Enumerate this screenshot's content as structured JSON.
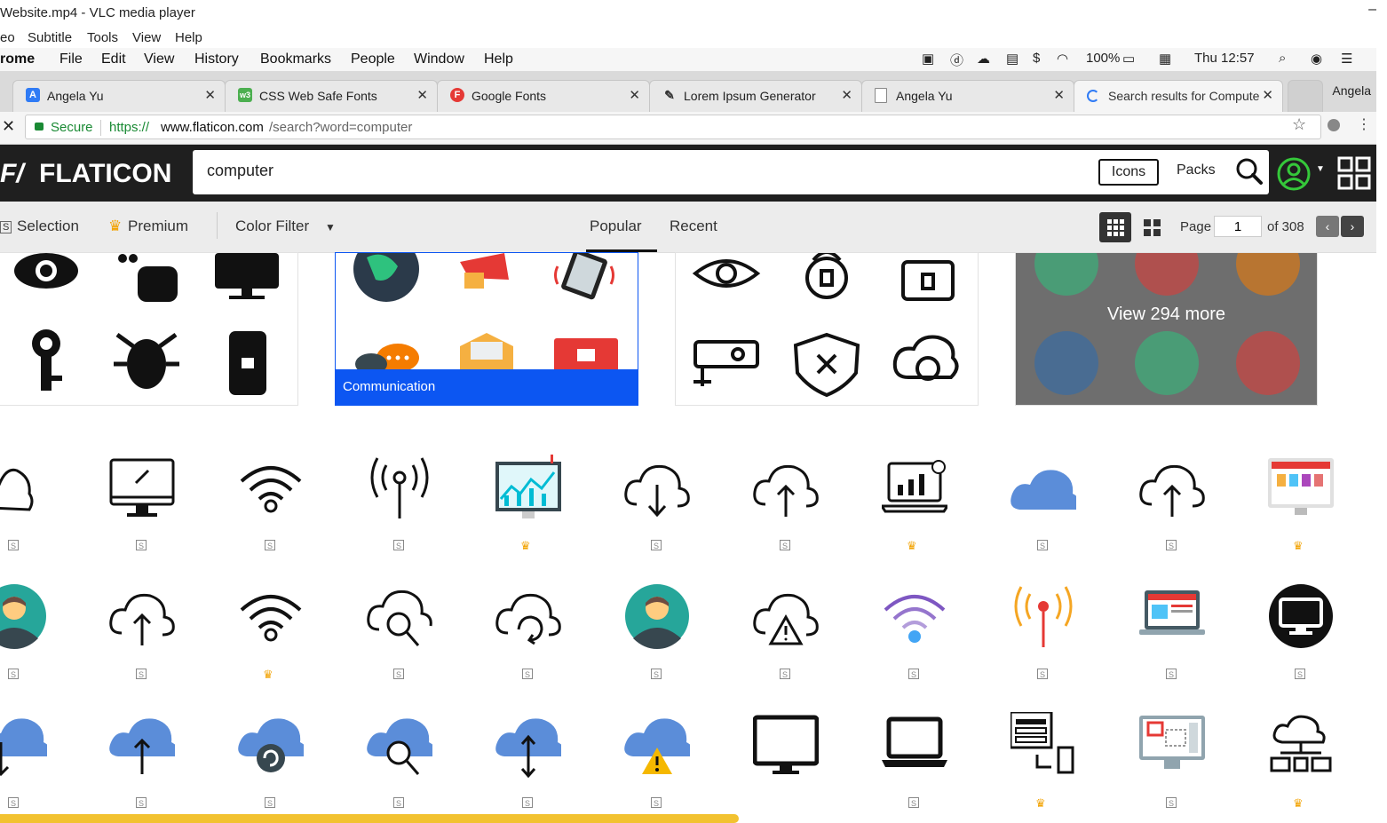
{
  "vlc": {
    "title": "Website.mp4 - VLC media player",
    "minimize": "–",
    "menu": [
      "eo",
      "Subtitle",
      "Tools",
      "View",
      "Help"
    ]
  },
  "mac": {
    "app": "rome",
    "menu": [
      "File",
      "Edit",
      "View",
      "History",
      "Bookmarks",
      "People",
      "Window",
      "Help"
    ],
    "battery": "100%",
    "clock": "Thu 12:57"
  },
  "tabs": [
    {
      "label": "Angela Yu",
      "favicon": "A",
      "color": "#2f7bf5"
    },
    {
      "label": "CSS Web Safe Fonts",
      "favicon": "w3",
      "color": "#4caf50"
    },
    {
      "label": "Google Fonts",
      "favicon": "F",
      "color": "#e53935"
    },
    {
      "label": "Lorem Ipsum Generator",
      "favicon": "✎",
      "color": "#333333"
    },
    {
      "label": "Angela Yu",
      "favicon": "",
      "color": "#dddddd"
    },
    {
      "label": "Search results for Compute",
      "favicon": "",
      "color": "#2f7bf5"
    }
  ],
  "tab_user": "Angela",
  "address": {
    "secure": "Secure",
    "scheme": "https://",
    "host": "www.flaticon.com",
    "path": "/search?word=computer"
  },
  "flaticon": {
    "logo_text": "FLATICON",
    "search_value": "computer",
    "icons_btn": "Icons",
    "packs_btn": "Packs"
  },
  "filters": {
    "selection": "Selection",
    "premium": "Premium",
    "color_filter": "Color Filter",
    "popular": "Popular",
    "recent": "Recent",
    "page_label": "Page",
    "page_value": "1",
    "of_pages": "of 308"
  },
  "packs": {
    "communication": "Communication",
    "more": "View 294 more"
  },
  "badges": {
    "selection": "S"
  },
  "colors": {
    "brand_dark": "#1f1f1f",
    "pack_label": "#0c56f2",
    "premium_crown": "#f2a200",
    "secure_green": "#1a8a34",
    "icon_blue": "#5b8dd9"
  },
  "icon_rows": [
    [
      "cloud-icon",
      "computer-monitor-icon",
      "wifi-icon",
      "antenna-icon",
      "analytics-monitor-icon",
      "cloud-download-icon",
      "cloud-upload-icon",
      "laptop-chart-icon",
      "blue-cloud-icon",
      "cloud-upload-icon",
      "monitor-website-icon"
    ],
    [
      "user-avatar-icon",
      "cloud-upload-icon",
      "wifi-icon",
      "cloud-search-icon",
      "cloud-sync-icon",
      "user-avatar-icon",
      "cloud-warning-icon",
      "wifi-icon",
      "antenna-icon",
      "laptop-website-icon",
      "monitor-circle-icon"
    ],
    [
      "cloud-download-icon",
      "cloud-upload-icon",
      "cloud-sync-icon",
      "cloud-search-icon",
      "cloud-transfer-icon",
      "cloud-warning-icon",
      "monitor-icon",
      "laptop-icon",
      "wireframe-icon",
      "monitor-design-icon",
      "cloud-network-icon"
    ]
  ],
  "premium_rows": [
    [
      false,
      false,
      false,
      false,
      true,
      false,
      false,
      true,
      false,
      false,
      true
    ],
    [
      false,
      false,
      true,
      false,
      false,
      false,
      false,
      false,
      false,
      false,
      false
    ],
    [
      false,
      false,
      false,
      false,
      false,
      false,
      null,
      false,
      true,
      false,
      true
    ]
  ]
}
